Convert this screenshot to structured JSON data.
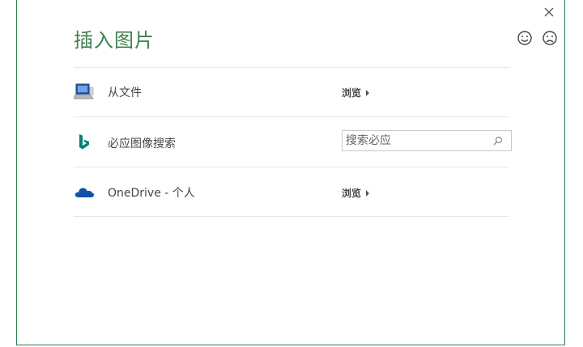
{
  "dialog": {
    "title": "插入图片",
    "close_label": "✕"
  },
  "feedback": {
    "smile_icon": "smile-icon",
    "frown_icon": "frown-icon"
  },
  "rows": [
    {
      "label": "从文件",
      "icon": "computer-icon",
      "action_label": "浏览"
    },
    {
      "label": "必应图像搜索",
      "icon": "bing-icon",
      "search_placeholder": "搜索必应",
      "search_icon": "search-icon"
    },
    {
      "label": "OneDrive - 个人",
      "icon": "onedrive-cloud-icon",
      "action_label": "浏览"
    }
  ],
  "colors": {
    "accent": "#3f7f4f",
    "border": "#2e7d4f",
    "bing": "#008373",
    "onedrive": "#0f52a8"
  }
}
